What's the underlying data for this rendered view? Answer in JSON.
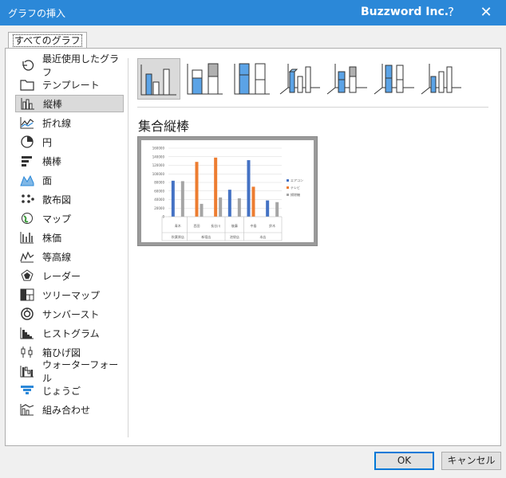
{
  "window": {
    "title": "グラフの挿入",
    "brand": "Buzzword Inc.",
    "help_label": "?",
    "close_label": "✕"
  },
  "tab": {
    "label": "すべてのグラフ"
  },
  "sidebar": {
    "items": [
      {
        "label": "最近使用したグラフ",
        "icon": "recent-icon"
      },
      {
        "label": "テンプレート",
        "icon": "folder-icon"
      },
      {
        "label": "縦棒",
        "icon": "column-chart-icon",
        "selected": true
      },
      {
        "label": "折れ線",
        "icon": "line-chart-icon"
      },
      {
        "label": "円",
        "icon": "pie-chart-icon"
      },
      {
        "label": "横棒",
        "icon": "bar-chart-icon"
      },
      {
        "label": "面",
        "icon": "area-chart-icon"
      },
      {
        "label": "散布図",
        "icon": "scatter-chart-icon"
      },
      {
        "label": "マップ",
        "icon": "map-chart-icon"
      },
      {
        "label": "株価",
        "icon": "stock-chart-icon"
      },
      {
        "label": "等高線",
        "icon": "surface-chart-icon"
      },
      {
        "label": "レーダー",
        "icon": "radar-chart-icon"
      },
      {
        "label": "ツリーマップ",
        "icon": "treemap-chart-icon"
      },
      {
        "label": "サンバースト",
        "icon": "sunburst-chart-icon"
      },
      {
        "label": "ヒストグラム",
        "icon": "histogram-chart-icon"
      },
      {
        "label": "箱ひげ図",
        "icon": "boxwhisker-chart-icon"
      },
      {
        "label": "ウォーターフォール",
        "icon": "waterfall-chart-icon"
      },
      {
        "label": "じょうご",
        "icon": "funnel-chart-icon"
      },
      {
        "label": "組み合わせ",
        "icon": "combo-chart-icon"
      }
    ]
  },
  "subtypes": [
    {
      "id": "clustered-column",
      "selected": true
    },
    {
      "id": "stacked-column"
    },
    {
      "id": "100-stacked-column"
    },
    {
      "id": "3d-clustered-column"
    },
    {
      "id": "3d-stacked-column"
    },
    {
      "id": "3d-100-stacked-column"
    },
    {
      "id": "3d-column"
    }
  ],
  "preview": {
    "heading": "集合縦棒"
  },
  "chart_data": {
    "type": "bar",
    "categories": [
      "青木",
      "西田",
      "長谷川",
      "後藤",
      "中島",
      "鈴木"
    ],
    "groups": [
      {
        "label": "秋葉原店",
        "categories": [
          "青木"
        ]
      },
      {
        "label": "新宿店",
        "categories": [
          "西田",
          "長谷川"
        ]
      },
      {
        "label": "池袋店",
        "categories": [
          "後藤"
        ]
      },
      {
        "label": "本店",
        "categories": [
          "中島",
          "鈴木"
        ]
      }
    ],
    "series": [
      {
        "name": "エアコン",
        "color": "#4472c4",
        "values": [
          84000,
          null,
          null,
          63000,
          132000,
          38000
        ]
      },
      {
        "name": "テレビ",
        "color": "#ed7d31",
        "values": [
          null,
          128000,
          138000,
          null,
          70000,
          null
        ]
      },
      {
        "name": "掃除機",
        "color": "#a5a5a5",
        "values": [
          83000,
          30000,
          45000,
          43000,
          null,
          34000
        ]
      }
    ],
    "ylim": [
      0,
      160000
    ],
    "yticks": [
      "0",
      "20000",
      "40000",
      "60000",
      "80000",
      "100000",
      "120000",
      "140000",
      "160000"
    ],
    "legend": "right",
    "grid": true
  },
  "buttons": {
    "ok": "OK",
    "cancel": "キャンセル"
  }
}
